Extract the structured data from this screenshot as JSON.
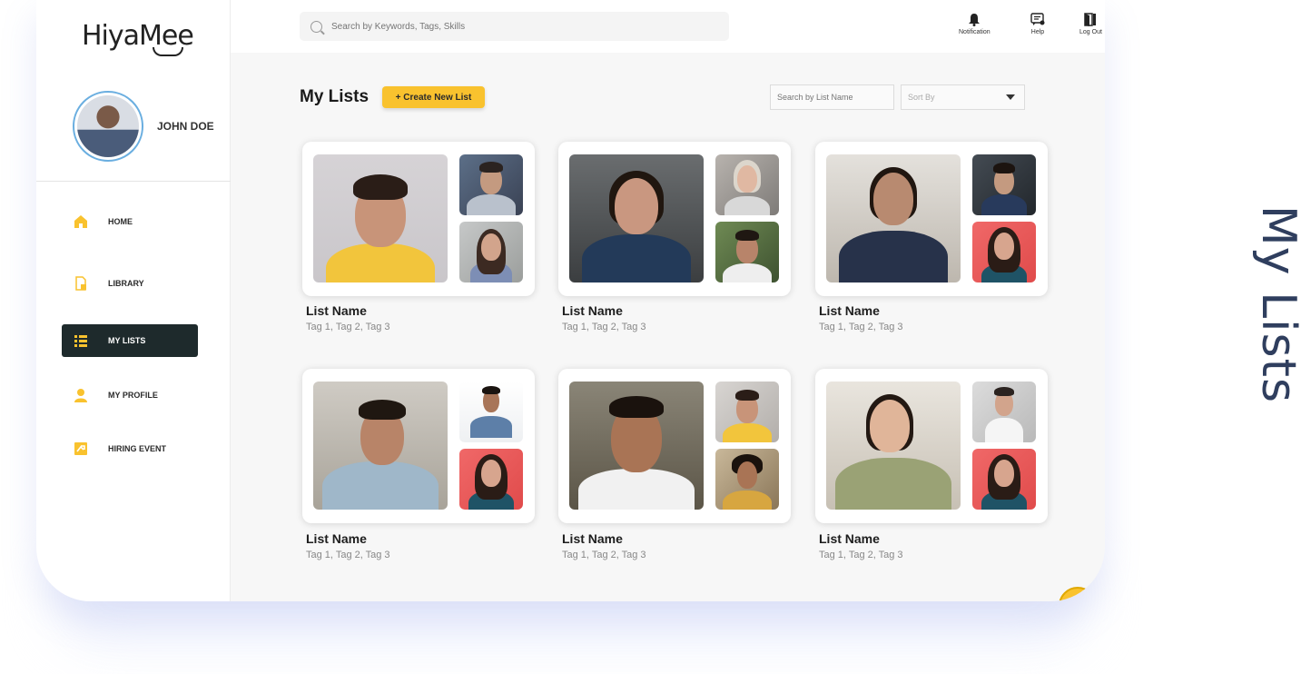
{
  "app": {
    "logo": "HiyaMee"
  },
  "user": {
    "name": "JOHN DOE"
  },
  "sidebar": {
    "items": [
      {
        "label": "HOME",
        "icon": "home-icon"
      },
      {
        "label": "LIBRARY",
        "icon": "library-icon"
      },
      {
        "label": "MY LISTS",
        "icon": "list-icon",
        "active": true
      },
      {
        "label": "MY PROFILE",
        "icon": "profile-icon"
      },
      {
        "label": "HIRING EVENT",
        "icon": "hiring-event-icon"
      }
    ]
  },
  "topbar": {
    "search_placeholder": "Search by Keywords, Tags, Skills",
    "actions": [
      {
        "label": "Notification",
        "icon": "bell-icon"
      },
      {
        "label": "Help",
        "icon": "help-icon"
      },
      {
        "label": "Log Out",
        "icon": "logout-icon"
      }
    ]
  },
  "main": {
    "title": "My Lists",
    "create_label": "+ Create New List",
    "list_search_placeholder": "Search by List Name",
    "sort_label": "Sort By",
    "cards": [
      {
        "title": "List Name",
        "tags": "Tag 1, Tag 2, Tag 3"
      },
      {
        "title": "List Name",
        "tags": "Tag 1, Tag 2, Tag 3"
      },
      {
        "title": "List Name",
        "tags": "Tag 1, Tag 2, Tag 3"
      },
      {
        "title": "List Name",
        "tags": "Tag 1, Tag 2, Tag 3"
      },
      {
        "title": "List Name",
        "tags": "Tag 1, Tag 2, Tag 3"
      },
      {
        "title": "List Name",
        "tags": "Tag 1, Tag 2, Tag 3"
      }
    ]
  },
  "side_heading": "My Lists",
  "colors": {
    "accent": "#f9c22e",
    "active_nav": "#1e2a2c",
    "heading": "#2f3e5e"
  }
}
